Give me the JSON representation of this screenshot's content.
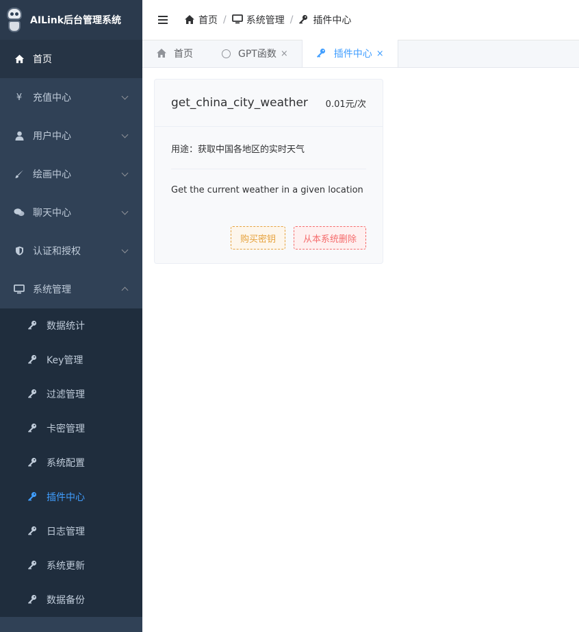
{
  "app": {
    "title": "AILink后台管理系统"
  },
  "sidebar": {
    "items": [
      {
        "label": "首页",
        "icon": "home-icon"
      },
      {
        "label": "充值中心",
        "icon": "yen-icon"
      },
      {
        "label": "用户中心",
        "icon": "user-icon"
      },
      {
        "label": "绘画中心",
        "icon": "brush-icon"
      },
      {
        "label": "聊天中心",
        "icon": "chat-icon"
      },
      {
        "label": "认证和授权",
        "icon": "shield-icon"
      },
      {
        "label": "系统管理",
        "icon": "monitor-icon"
      }
    ],
    "yen_glyph": "¥",
    "submenu": [
      {
        "label": "数据统计"
      },
      {
        "label": "Key管理"
      },
      {
        "label": "过滤管理"
      },
      {
        "label": "卡密管理"
      },
      {
        "label": "系统配置"
      },
      {
        "label": "插件中心"
      },
      {
        "label": "日志管理"
      },
      {
        "label": "系统更新"
      },
      {
        "label": "数据备份"
      }
    ],
    "active_color": "#409eff",
    "background": "#304156"
  },
  "breadcrumb": {
    "items": [
      "首页",
      "系统管理",
      "插件中心"
    ],
    "separator": "/"
  },
  "tags": [
    {
      "label": "首页"
    },
    {
      "label": "GPT函数",
      "close": "×"
    },
    {
      "label": "插件中心",
      "close": "×"
    }
  ],
  "plugin_card": {
    "name": "get_china_city_weather",
    "price": "0.01元/次",
    "purpose": "用途：获取中国各地区的实时天气",
    "description": "Get the current weather in a given location",
    "buy_button": "购买密钥",
    "delete_button": "从本系统删除"
  }
}
